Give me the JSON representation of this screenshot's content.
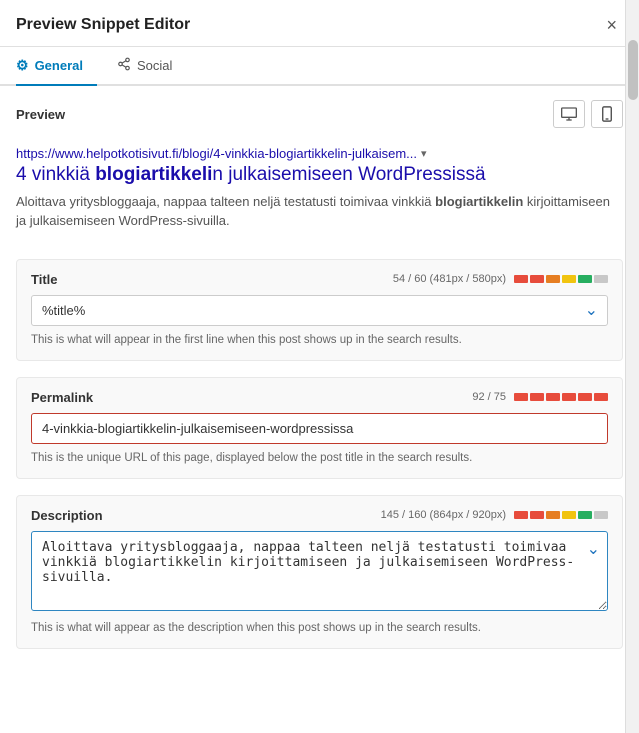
{
  "header": {
    "title": "Preview Snippet Editor",
    "close_label": "×"
  },
  "tabs": [
    {
      "id": "general",
      "label": "General",
      "icon": "⚙",
      "active": true
    },
    {
      "id": "social",
      "label": "Social",
      "icon": "🔗",
      "active": false
    }
  ],
  "preview": {
    "section_label": "Preview",
    "url": "https://www.helpotkotisivut.fi/blogi/4-vinkkia-blogiartikkelin-julkaisem...",
    "url_dropdown": "▾",
    "title_html": "4 vinkkiä <strong>blogiartikkeli</strong>n julkaisemiseen WordPressissä",
    "title_plain": "4 vinkkiä blogiartikkelin julkaisemiseen WordPressissä",
    "description_html": "Aloittava yritysbloggaaja, nappaa talteen neljä testatusti toimivaa vinkkiä <strong>blogiartikkelin</strong> kirjoittamiseen ja julkaisemiseen WordPress-sivuilla.",
    "description_plain": "Aloittava yritysbloggaaja, nappaa talteen neljä testatusti toimivaa vinkkiä blogiartikkelin kirjoittamiseen ja julkaisemiseen WordPress-sivuilla."
  },
  "fields": {
    "title": {
      "label": "Title",
      "meta": "54 / 60 (481px / 580px)",
      "value": "%title%",
      "hint": "This is what will appear in the first line when this post shows up in the search results.",
      "progress": [
        {
          "color": "#e74c3c"
        },
        {
          "color": "#e74c3c"
        },
        {
          "color": "#e67e22"
        },
        {
          "color": "#f1c40f"
        },
        {
          "color": "#27ae60"
        },
        {
          "color": "#c8c8c8"
        }
      ]
    },
    "permalink": {
      "label": "Permalink",
      "meta": "92 / 75",
      "value": "4-vinkkia-blogiartikkelin-julkaisemiseen-wordpressissa",
      "hint": "This is the unique URL of this page, displayed below the post title in the search results.",
      "progress": [
        {
          "color": "#e74c3c"
        },
        {
          "color": "#e74c3c"
        },
        {
          "color": "#e74c3c"
        },
        {
          "color": "#e74c3c"
        },
        {
          "color": "#e74c3c"
        },
        {
          "color": "#e74c3c"
        }
      ]
    },
    "description": {
      "label": "Description",
      "meta": "145 / 160 (864px / 920px)",
      "value": "Aloittava yritysbloggaaja, nappaa talteen neljä testatusti toimivaa vinkkiä blogiartikkelin kirjoittamiseen ja julkaisemiseen WordPress-sivuilla.",
      "hint": "This is what will appear as the description when this post shows up in the search results.",
      "progress": [
        {
          "color": "#e74c3c"
        },
        {
          "color": "#e74c3c"
        },
        {
          "color": "#e67e22"
        },
        {
          "color": "#f1c40f"
        },
        {
          "color": "#27ae60"
        },
        {
          "color": "#c8c8c8"
        }
      ]
    }
  },
  "icons": {
    "desktop": "🖥",
    "mobile": "📱",
    "gear": "⚙",
    "share": "🔗"
  }
}
